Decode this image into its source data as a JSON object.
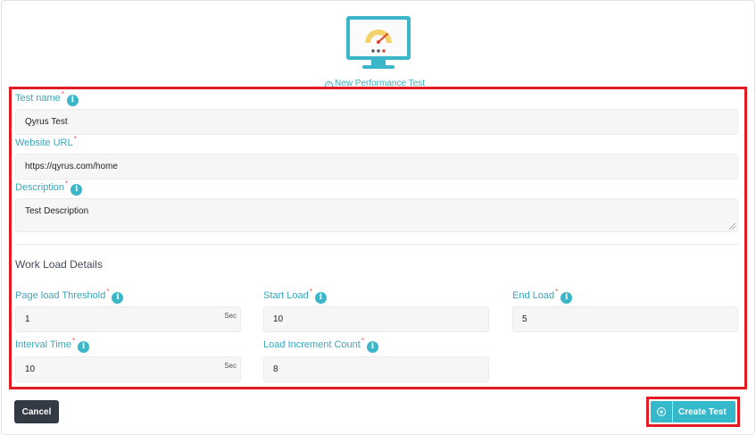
{
  "header": {
    "subtitle": "New Performance Test",
    "illustration_icon": "monitor-speedometer-icon"
  },
  "form": {
    "test_name": {
      "label": "Test name",
      "required": "*",
      "value": "Qyrus Test"
    },
    "website_url": {
      "label": "Website URL",
      "required": "*",
      "value": "https://qyrus.com/home"
    },
    "description": {
      "label": "Description",
      "required": "*",
      "value": "Test Description"
    }
  },
  "workload": {
    "title": "Work Load Details",
    "page_load_threshold": {
      "label": "Page load Threshold",
      "required": "*",
      "value": "1",
      "unit": "Sec"
    },
    "start_load": {
      "label": "Start Load",
      "required": "*",
      "value": "10"
    },
    "end_load": {
      "label": "End Load",
      "required": "*",
      "value": "5"
    },
    "interval_time": {
      "label": "Interval Time",
      "required": "*",
      "value": "10",
      "unit": "Sec"
    },
    "load_increment_count": {
      "label": "Load Increment Count",
      "required": "*",
      "value": "8"
    }
  },
  "actions": {
    "cancel_label": "Cancel",
    "create_label": "Create Test"
  },
  "colors": {
    "accent": "#3ab6c8",
    "highlight": "#e31b23",
    "cancel_bg": "#333a44"
  }
}
